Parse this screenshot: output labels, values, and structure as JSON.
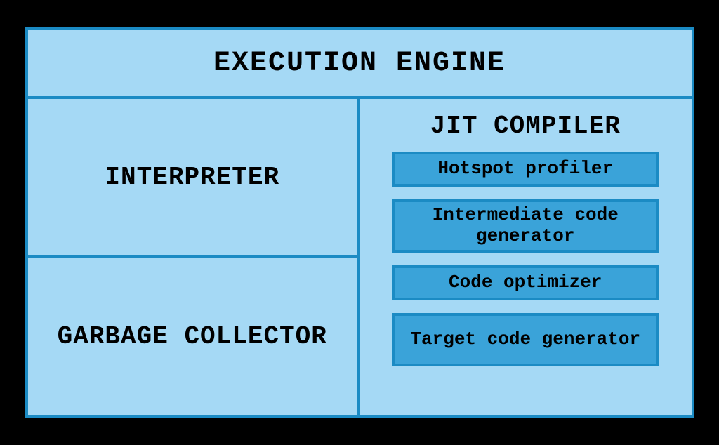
{
  "title": "EXECUTION ENGINE",
  "left": {
    "interpreter": "INTERPRETER",
    "garbage_collector": "GARBAGE COLLECTOR"
  },
  "jit": {
    "title": "JIT COMPILER",
    "boxes": {
      "profiler": "Hotspot profiler",
      "icg": "Intermediate code generator",
      "optimizer": "Code optimizer",
      "tcg": "Target code generator"
    }
  }
}
